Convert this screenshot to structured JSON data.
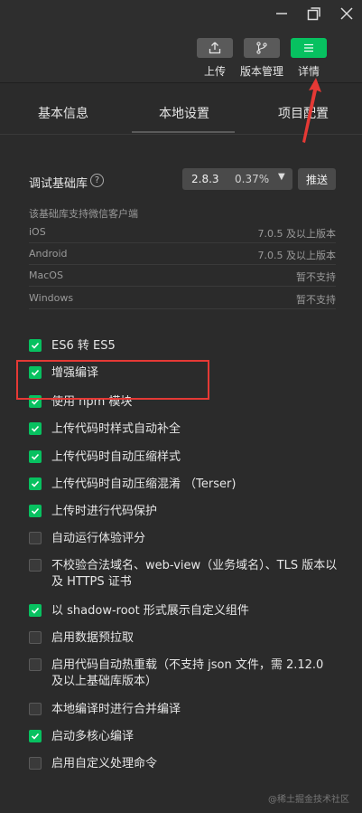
{
  "window": {
    "minimize_icon": "minimize-icon",
    "maximize_icon": "maximize-icon",
    "close_icon": "close-icon"
  },
  "toolbar": {
    "upload_label": "上传",
    "version_label": "版本管理",
    "detail_label": "详情"
  },
  "tabs": {
    "basic": "基本信息",
    "local": "本地设置",
    "project": "项目配置"
  },
  "base_library": {
    "label": "调试基础库",
    "help": "?",
    "version": "2.8.3",
    "percent": "0.37%",
    "push_label": "推送",
    "support_title": "该基础库支持微信客户端",
    "rows": [
      {
        "os": "iOS",
        "ver": "7.0.5 及以上版本"
      },
      {
        "os": "Android",
        "ver": "7.0.5 及以上版本"
      },
      {
        "os": "MacOS",
        "ver": "暂不支持"
      },
      {
        "os": "Windows",
        "ver": "暂不支持"
      }
    ]
  },
  "settings": [
    {
      "label": "ES6 转 ES5",
      "checked": true
    },
    {
      "label": "增强编译",
      "checked": true
    },
    {
      "label": "使用 npm 模块",
      "checked": true
    },
    {
      "label": "上传代码时样式自动补全",
      "checked": true
    },
    {
      "label": "上传代码时自动压缩样式",
      "checked": true
    },
    {
      "label": "上传代码时自动压缩混淆 （Terser)",
      "checked": true
    },
    {
      "label": "上传时进行代码保护",
      "checked": true
    },
    {
      "label": "自动运行体验评分",
      "checked": false
    },
    {
      "label": "不校验合法域名、web-view（业务域名）、TLS 版本以及 HTTPS 证书",
      "checked": false
    },
    {
      "label": "以 shadow-root 形式展示自定义组件",
      "checked": true
    },
    {
      "label": "启用数据预拉取",
      "checked": false
    },
    {
      "label": "启用代码自动热重载（不支持 json 文件，需 2.12.0 及以上基础库版本）",
      "checked": false
    },
    {
      "label": "本地编译时进行合并编译",
      "checked": false
    },
    {
      "label": "启动多核心编译",
      "checked": true
    },
    {
      "label": "启用自定义处理命令",
      "checked": false
    }
  ],
  "watermark": "@稀土掘金技术社区",
  "colors": {
    "accent": "#07c160",
    "annotation": "#e53935",
    "background": "#2b2b2b"
  }
}
